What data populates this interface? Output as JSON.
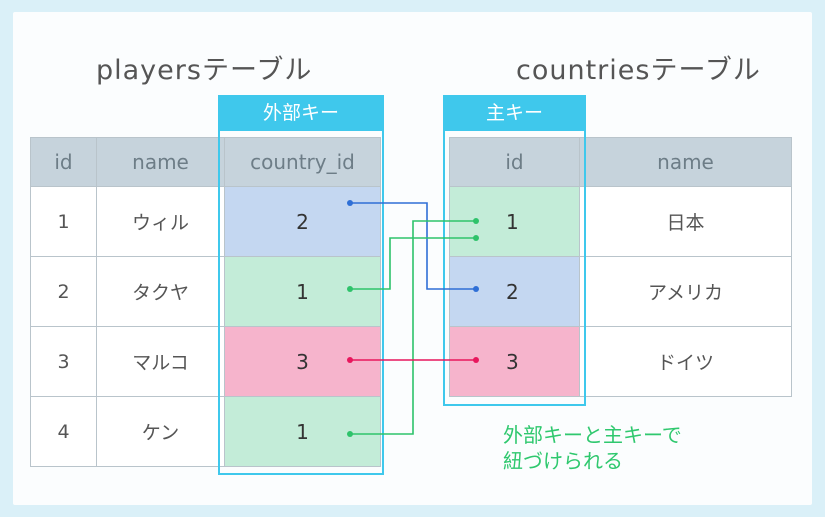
{
  "players_title": "playersテーブル",
  "countries_title": "countriesテーブル",
  "foreign_key_label": "外部キー",
  "primary_key_label": "主キー",
  "players": {
    "headers": [
      "id",
      "name",
      "country_id"
    ],
    "rows": [
      {
        "id": "1",
        "name": "ウィル",
        "country_id": "2"
      },
      {
        "id": "2",
        "name": "タクヤ",
        "country_id": "1"
      },
      {
        "id": "3",
        "name": "マルコ",
        "country_id": "3"
      },
      {
        "id": "4",
        "name": "ケン",
        "country_id": "1"
      }
    ]
  },
  "countries": {
    "headers": [
      "id",
      "name"
    ],
    "rows": [
      {
        "id": "1",
        "name": "日本"
      },
      {
        "id": "2",
        "name": "アメリカ"
      },
      {
        "id": "3",
        "name": "ドイツ"
      }
    ]
  },
  "note_lines": [
    "外部キーと主キーで",
    "紐づけられる"
  ],
  "colors": {
    "accent": "#3fc8ec",
    "blue": "#c4d7f1",
    "green": "#c3ecd8",
    "pink": "#f6b4cc",
    "blue_line": "#2f6fd6",
    "green_line": "#2ec36b",
    "pink_line": "#e8175d"
  }
}
